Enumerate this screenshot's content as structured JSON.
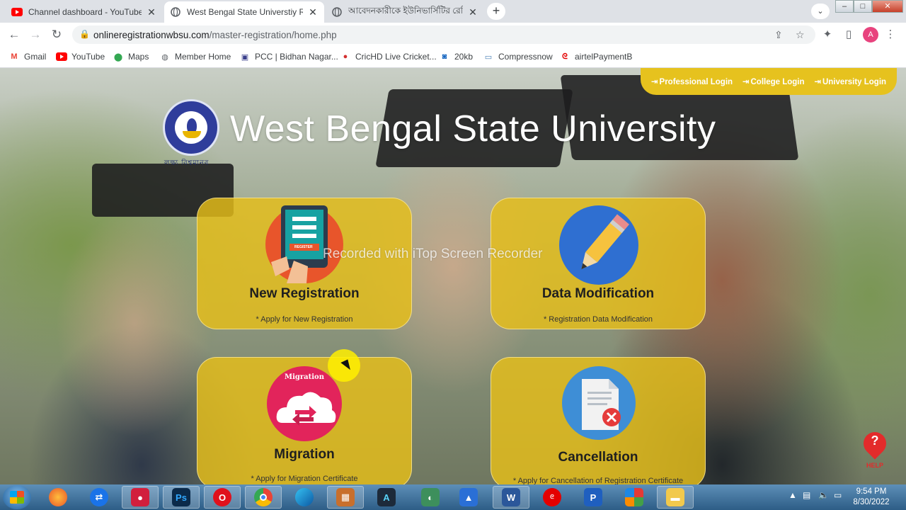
{
  "browser": {
    "tabs": [
      {
        "title": "Channel dashboard - YouTube Studio",
        "icon": "youtube-icon",
        "active": false
      },
      {
        "title": "West Bengal State Universtiy Registration",
        "icon": "globe-icon",
        "active": true
      },
      {
        "title": "আবেদনকারীকে ইউনিভার্সিটির রেজিস্ট্রেশন",
        "icon": "globe-icon",
        "active": false
      }
    ],
    "new_tab": "+",
    "tab_search": "⌄",
    "url_host": "onlineregistrationwbsu.com",
    "url_path": "/master-registration/home.php",
    "avatar_letter": "A",
    "bookmarks": [
      {
        "label": "Gmail",
        "icon": "gmail-icon"
      },
      {
        "label": "YouTube",
        "icon": "youtube-icon"
      },
      {
        "label": "Maps",
        "icon": "maps-icon"
      },
      {
        "label": "Member Home",
        "icon": "globe-icon"
      },
      {
        "label": "PCC | Bidhan Nagar...",
        "icon": "police-icon"
      },
      {
        "label": "CricHD Live Cricket...",
        "icon": "crichd-icon"
      },
      {
        "label": "20kb",
        "icon": "20kb-icon"
      },
      {
        "label": "Compressnow",
        "icon": "compress-icon"
      },
      {
        "label": "airtelPaymentB",
        "icon": "airtel-icon"
      }
    ]
  },
  "page": {
    "login_links": [
      {
        "label": "Professional Login"
      },
      {
        "label": "College Login"
      },
      {
        "label": "University Login"
      }
    ],
    "logo_caption": "লক্ষ্য বিশ্বমানব",
    "title": "West Bengal State University",
    "cards": [
      {
        "title": "New Registration",
        "subtitle": "* Apply for New Registration",
        "icon": "registration-tablet-icon",
        "icon_text": "REGISTER"
      },
      {
        "title": "Data Modification",
        "subtitle": "* Registration Data Modification",
        "icon": "pencil-icon"
      },
      {
        "title": "Migration",
        "subtitle": "* Apply for Migration Certificate",
        "icon": "migration-cloud-icon",
        "icon_text": "Migration"
      },
      {
        "title": "Cancellation",
        "subtitle": "* Apply for Cancellation of Registration Certificate",
        "icon": "document-cancel-icon"
      }
    ],
    "watermark": "Recorded with iTop Screen Recorder",
    "help_label": "HELP"
  },
  "taskbar": {
    "apps": [
      "firefox-icon",
      "teamviewer-icon",
      "itop-recorder-icon",
      "photoshop-icon",
      "opera-icon",
      "chrome-icon",
      "edge-icon",
      "paint-icon",
      "a-icon",
      "meet-icon",
      "maps-app-icon",
      "word-icon",
      "airtel-app-icon",
      "pay-icon",
      "apps-grid-icon",
      "file-explorer-icon"
    ],
    "time": "9:54 PM",
    "date": "8/30/2022",
    "ps_label": "Ps",
    "word_label": "W"
  },
  "colors": {
    "card_yellow": "#e6be19",
    "login_strip": "#e6c21e",
    "accent_red": "#e32b2b"
  }
}
